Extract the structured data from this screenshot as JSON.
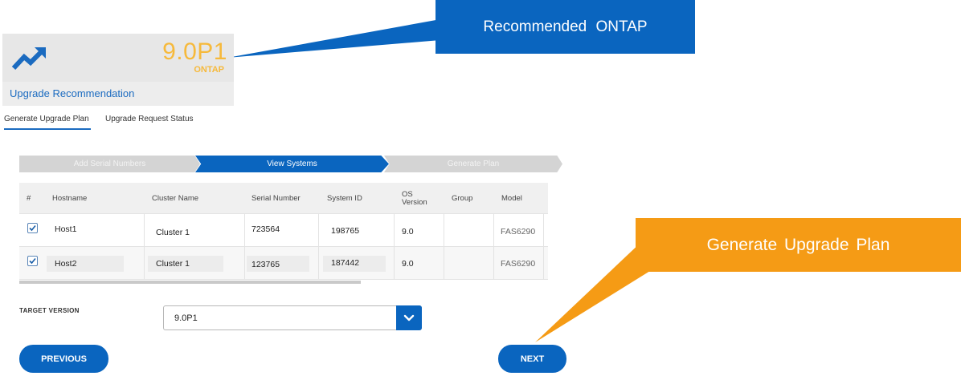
{
  "card": {
    "version": "9.0P1",
    "os": "ONTAP",
    "title": "Upgrade Recommendation",
    "icon": "trending-up-icon"
  },
  "callouts": {
    "ontap": "Recommended  ONTAP",
    "plan": "Generate  Upgrade  Plan"
  },
  "tabs": {
    "generate": "Generate Upgrade Plan",
    "status": "Upgrade Request Status"
  },
  "steps": [
    "Add Serial Numbers",
    "View Systems",
    "Generate Plan"
  ],
  "table": {
    "headers": {
      "num": "#",
      "hostname": "Hostname",
      "cluster": "Cluster Name",
      "serial": "Serial Number",
      "system_id": "System ID",
      "os_line1": "OS",
      "os_line2": "Version",
      "group": "Group",
      "model": "Model"
    },
    "rows": [
      {
        "checked": true,
        "hostname": "Host1",
        "cluster": "Cluster 1",
        "serial": "723564",
        "system_id": "198765",
        "os": "9.0",
        "group": "",
        "model": "FAS6290"
      },
      {
        "checked": true,
        "hostname": "Host2",
        "cluster": "Cluster 1",
        "serial": "123765",
        "system_id": "187442",
        "os": "9.0",
        "group": "",
        "model": "FAS6290"
      }
    ]
  },
  "target": {
    "label": "TARGET VERSION",
    "value": "9.0P1",
    "icon": "chevron-down-icon"
  },
  "buttons": {
    "previous": "PREVIOUS",
    "next": "NEXT"
  },
  "colors": {
    "primary": "#0a65bf",
    "accent_orange": "#f59b15",
    "version_yellow": "#f6b93b"
  }
}
